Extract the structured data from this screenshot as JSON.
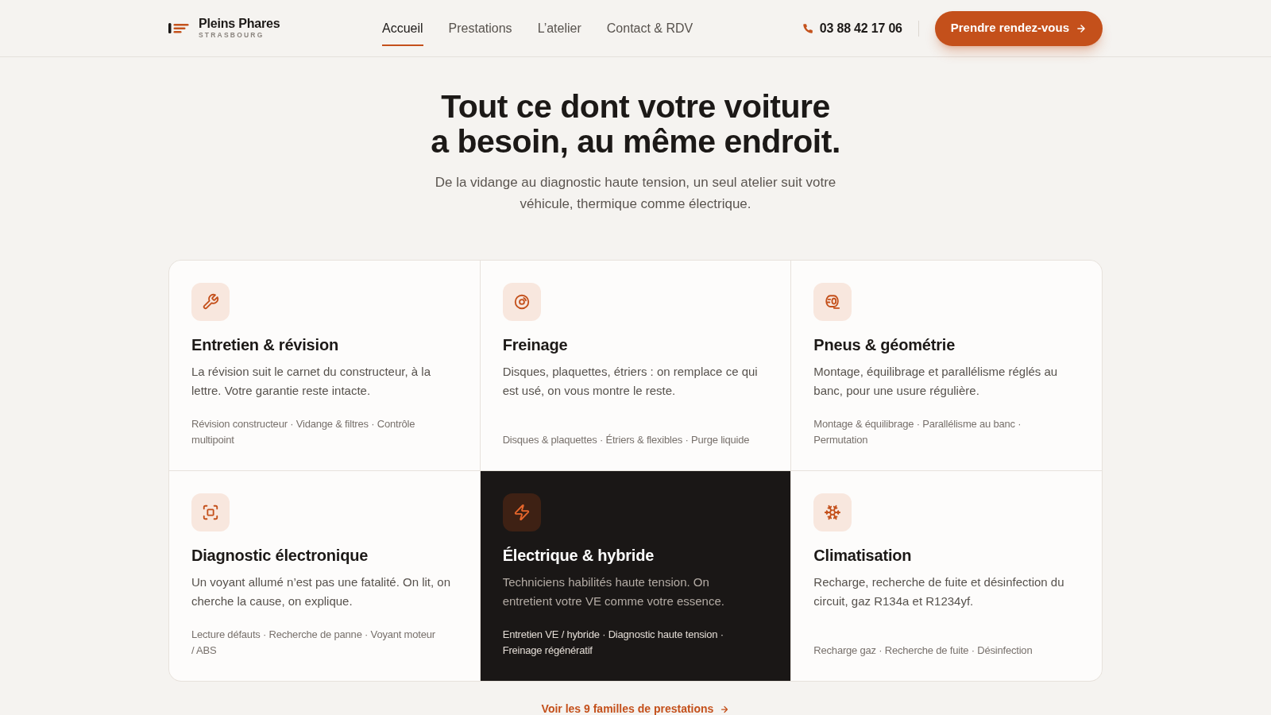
{
  "header": {
    "logo": {
      "name": "Pleins Phares",
      "tagline": "STRASBOURG"
    },
    "nav": [
      {
        "label": "Accueil",
        "selected": true
      },
      {
        "label": "Prestations",
        "selected": false
      },
      {
        "label": "L’atelier",
        "selected": false
      },
      {
        "label": "Contact & RDV",
        "selected": false
      }
    ],
    "phone": "03 88 42 17 06",
    "cta": "Prendre rendez-vous"
  },
  "hero": {
    "title_lines": [
      "Tout ce dont votre voiture",
      "a besoin, au même endroit."
    ],
    "subtitle_lines": [
      "De la vidange au diagnostic haute tension, un seul atelier suit votre",
      "véhicule, thermique comme électrique."
    ]
  },
  "services": [
    {
      "title": "Entretien & révision",
      "description": "La révision suit le carnet du constructeur, à la lettre. Votre garantie reste intacte.",
      "tags": "Révision constructeur · Vidange & filtres · Contrôle multipoint",
      "highlighted": false
    },
    {
      "title": "Freinage",
      "description": "Disques, plaquettes, étriers : on remplace ce qui est usé, on vous montre le reste.",
      "tags": "Disques & plaquettes · Étriers & flexibles · Purge liquide",
      "highlighted": false
    },
    {
      "title": "Pneus & géométrie",
      "description": "Montage, équilibrage et parallélisme réglés au banc, pour une usure régulière.",
      "tags": "Montage & équilibrage · Parallélisme au banc · Permutation",
      "highlighted": false
    },
    {
      "title": "Diagnostic électronique",
      "description": "Un voyant allumé n’est pas une fatalité. On lit, on cherche la cause, on explique.",
      "tags": "Lecture défauts · Recherche de panne · Voyant moteur / ABS",
      "highlighted": false
    },
    {
      "title": "Électrique & hybride",
      "description": "Techniciens habilités haute tension. On entretient votre VE comme votre essence.",
      "tags": "Entretien VE / hybride · Diagnostic haute tension · Freinage régénératif",
      "highlighted": true
    },
    {
      "title": "Climatisation",
      "description": "Recharge, recherche de fuite et désinfection du circuit, gaz R134a et R1234yf.",
      "tags": "Recharge gaz · Recherche de fuite · Désinfection",
      "highlighted": false
    }
  ],
  "more_link": "Voir les 9 familles de prestations"
}
